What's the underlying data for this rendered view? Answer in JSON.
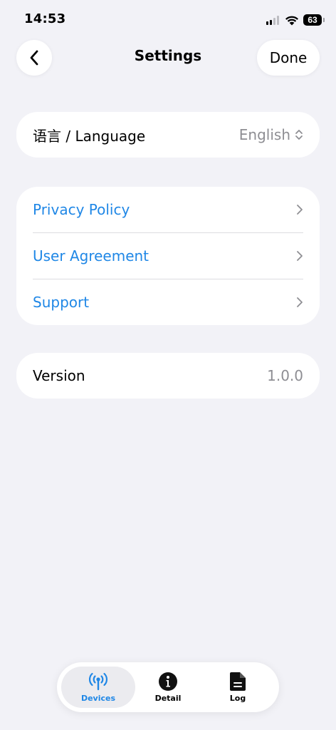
{
  "status_bar": {
    "time": "14:53",
    "battery_level": "63"
  },
  "nav": {
    "title": "Settings",
    "done_label": "Done",
    "back_icon": "chevron-left-icon"
  },
  "language_section": {
    "label": "语言 / Language",
    "value": "English",
    "icon": "up-down-chevron-icon"
  },
  "links_section": {
    "items": [
      {
        "label": "Privacy Policy"
      },
      {
        "label": "User Agreement"
      },
      {
        "label": "Support"
      }
    ],
    "link_color": "#1f87e6"
  },
  "version_section": {
    "label": "Version",
    "value": "1.0.0"
  },
  "tab_bar": {
    "tabs": [
      {
        "label": "Devices",
        "icon": "antenna-icon",
        "active": true
      },
      {
        "label": "Detail",
        "icon": "info-icon",
        "active": false
      },
      {
        "label": "Log",
        "icon": "document-icon",
        "active": false
      }
    ],
    "accent_color": "#1f87e6"
  }
}
